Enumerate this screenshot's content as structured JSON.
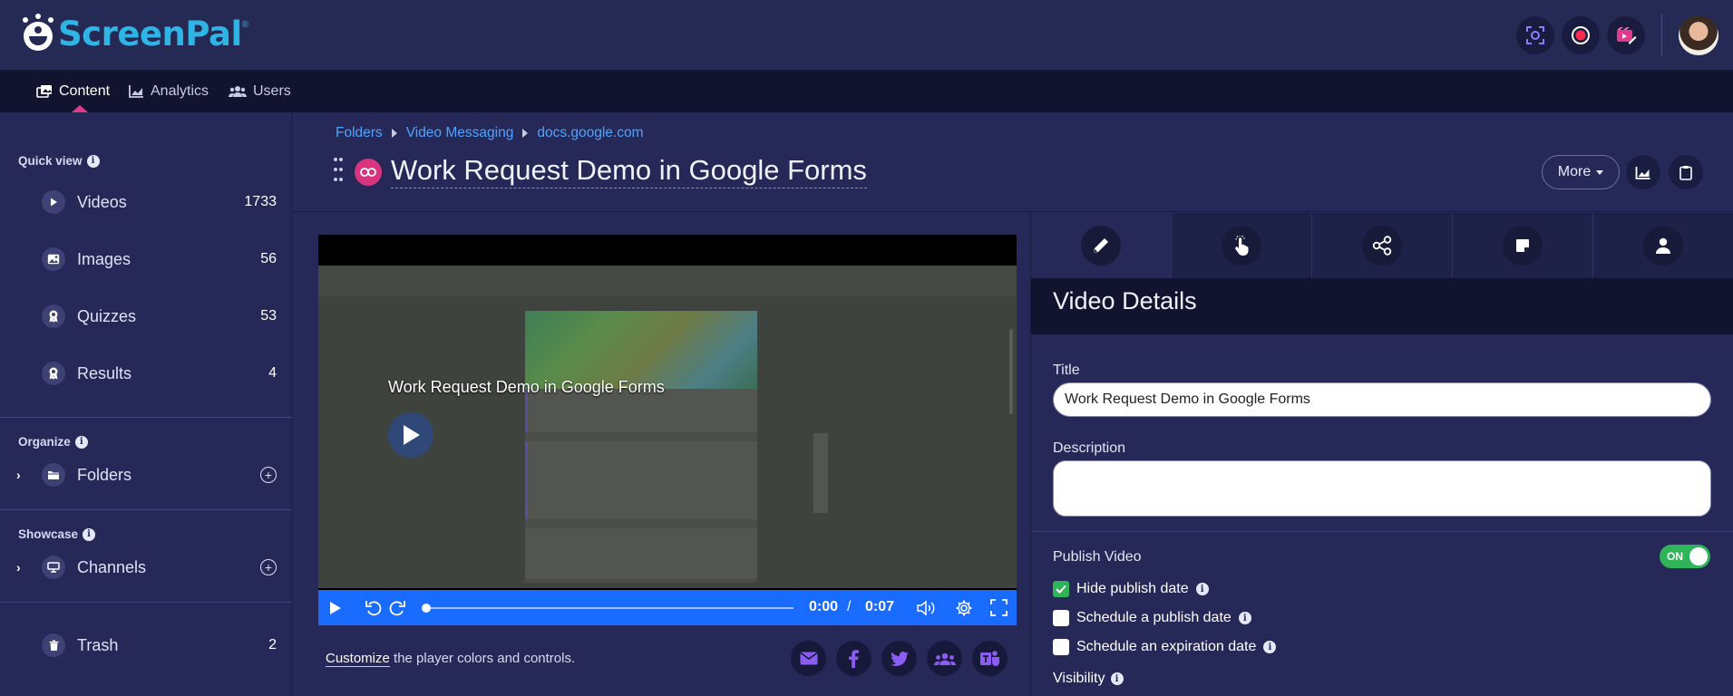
{
  "brand": {
    "name": "ScreenPal",
    "reg": "®"
  },
  "nav": {
    "content": "Content",
    "analytics": "Analytics",
    "users": "Users"
  },
  "sidebar": {
    "quick_view": "Quick view",
    "items": [
      {
        "label": "Videos",
        "count": "1733",
        "icon": "play-icon"
      },
      {
        "label": "Images",
        "count": "56",
        "icon": "image-icon"
      },
      {
        "label": "Quizzes",
        "count": "53",
        "icon": "ribbon-icon"
      },
      {
        "label": "Results",
        "count": "4",
        "icon": "ribbon-icon"
      }
    ],
    "organize": "Organize",
    "folders": "Folders",
    "showcase": "Showcase",
    "channels": "Channels",
    "trash": "Trash",
    "trash_count": "2"
  },
  "breadcrumb": [
    "Folders",
    "Video Messaging",
    "docs.google.com"
  ],
  "page_title": "Work Request Demo in Google Forms",
  "more_label": "More",
  "player": {
    "overlay_title": "Work Request Demo in Google Forms",
    "current_time": "0:00",
    "separator": "/",
    "duration": "0:07",
    "progress": 0
  },
  "customize": {
    "link": "Customize",
    "rest": " the player colors and controls."
  },
  "share": [
    "email-icon",
    "facebook-icon",
    "twitter-icon",
    "group-icon",
    "teams-icon"
  ],
  "details": {
    "heading": "Video Details",
    "title_label": "Title",
    "title_value": "Work Request Demo in Google Forms",
    "description_label": "Description",
    "description_value": "",
    "publish_label": "Publish Video",
    "publish_toggle": "ON",
    "hide_publish_date": "Hide publish date",
    "schedule_publish": "Schedule a publish date",
    "schedule_expiration": "Schedule an expiration date",
    "visibility": "Visibility"
  },
  "colors": {
    "accent": "#2fb4e6",
    "pink": "#d9357f",
    "player_bar": "#1a6bff",
    "toggle_on": "#2fb45a"
  }
}
